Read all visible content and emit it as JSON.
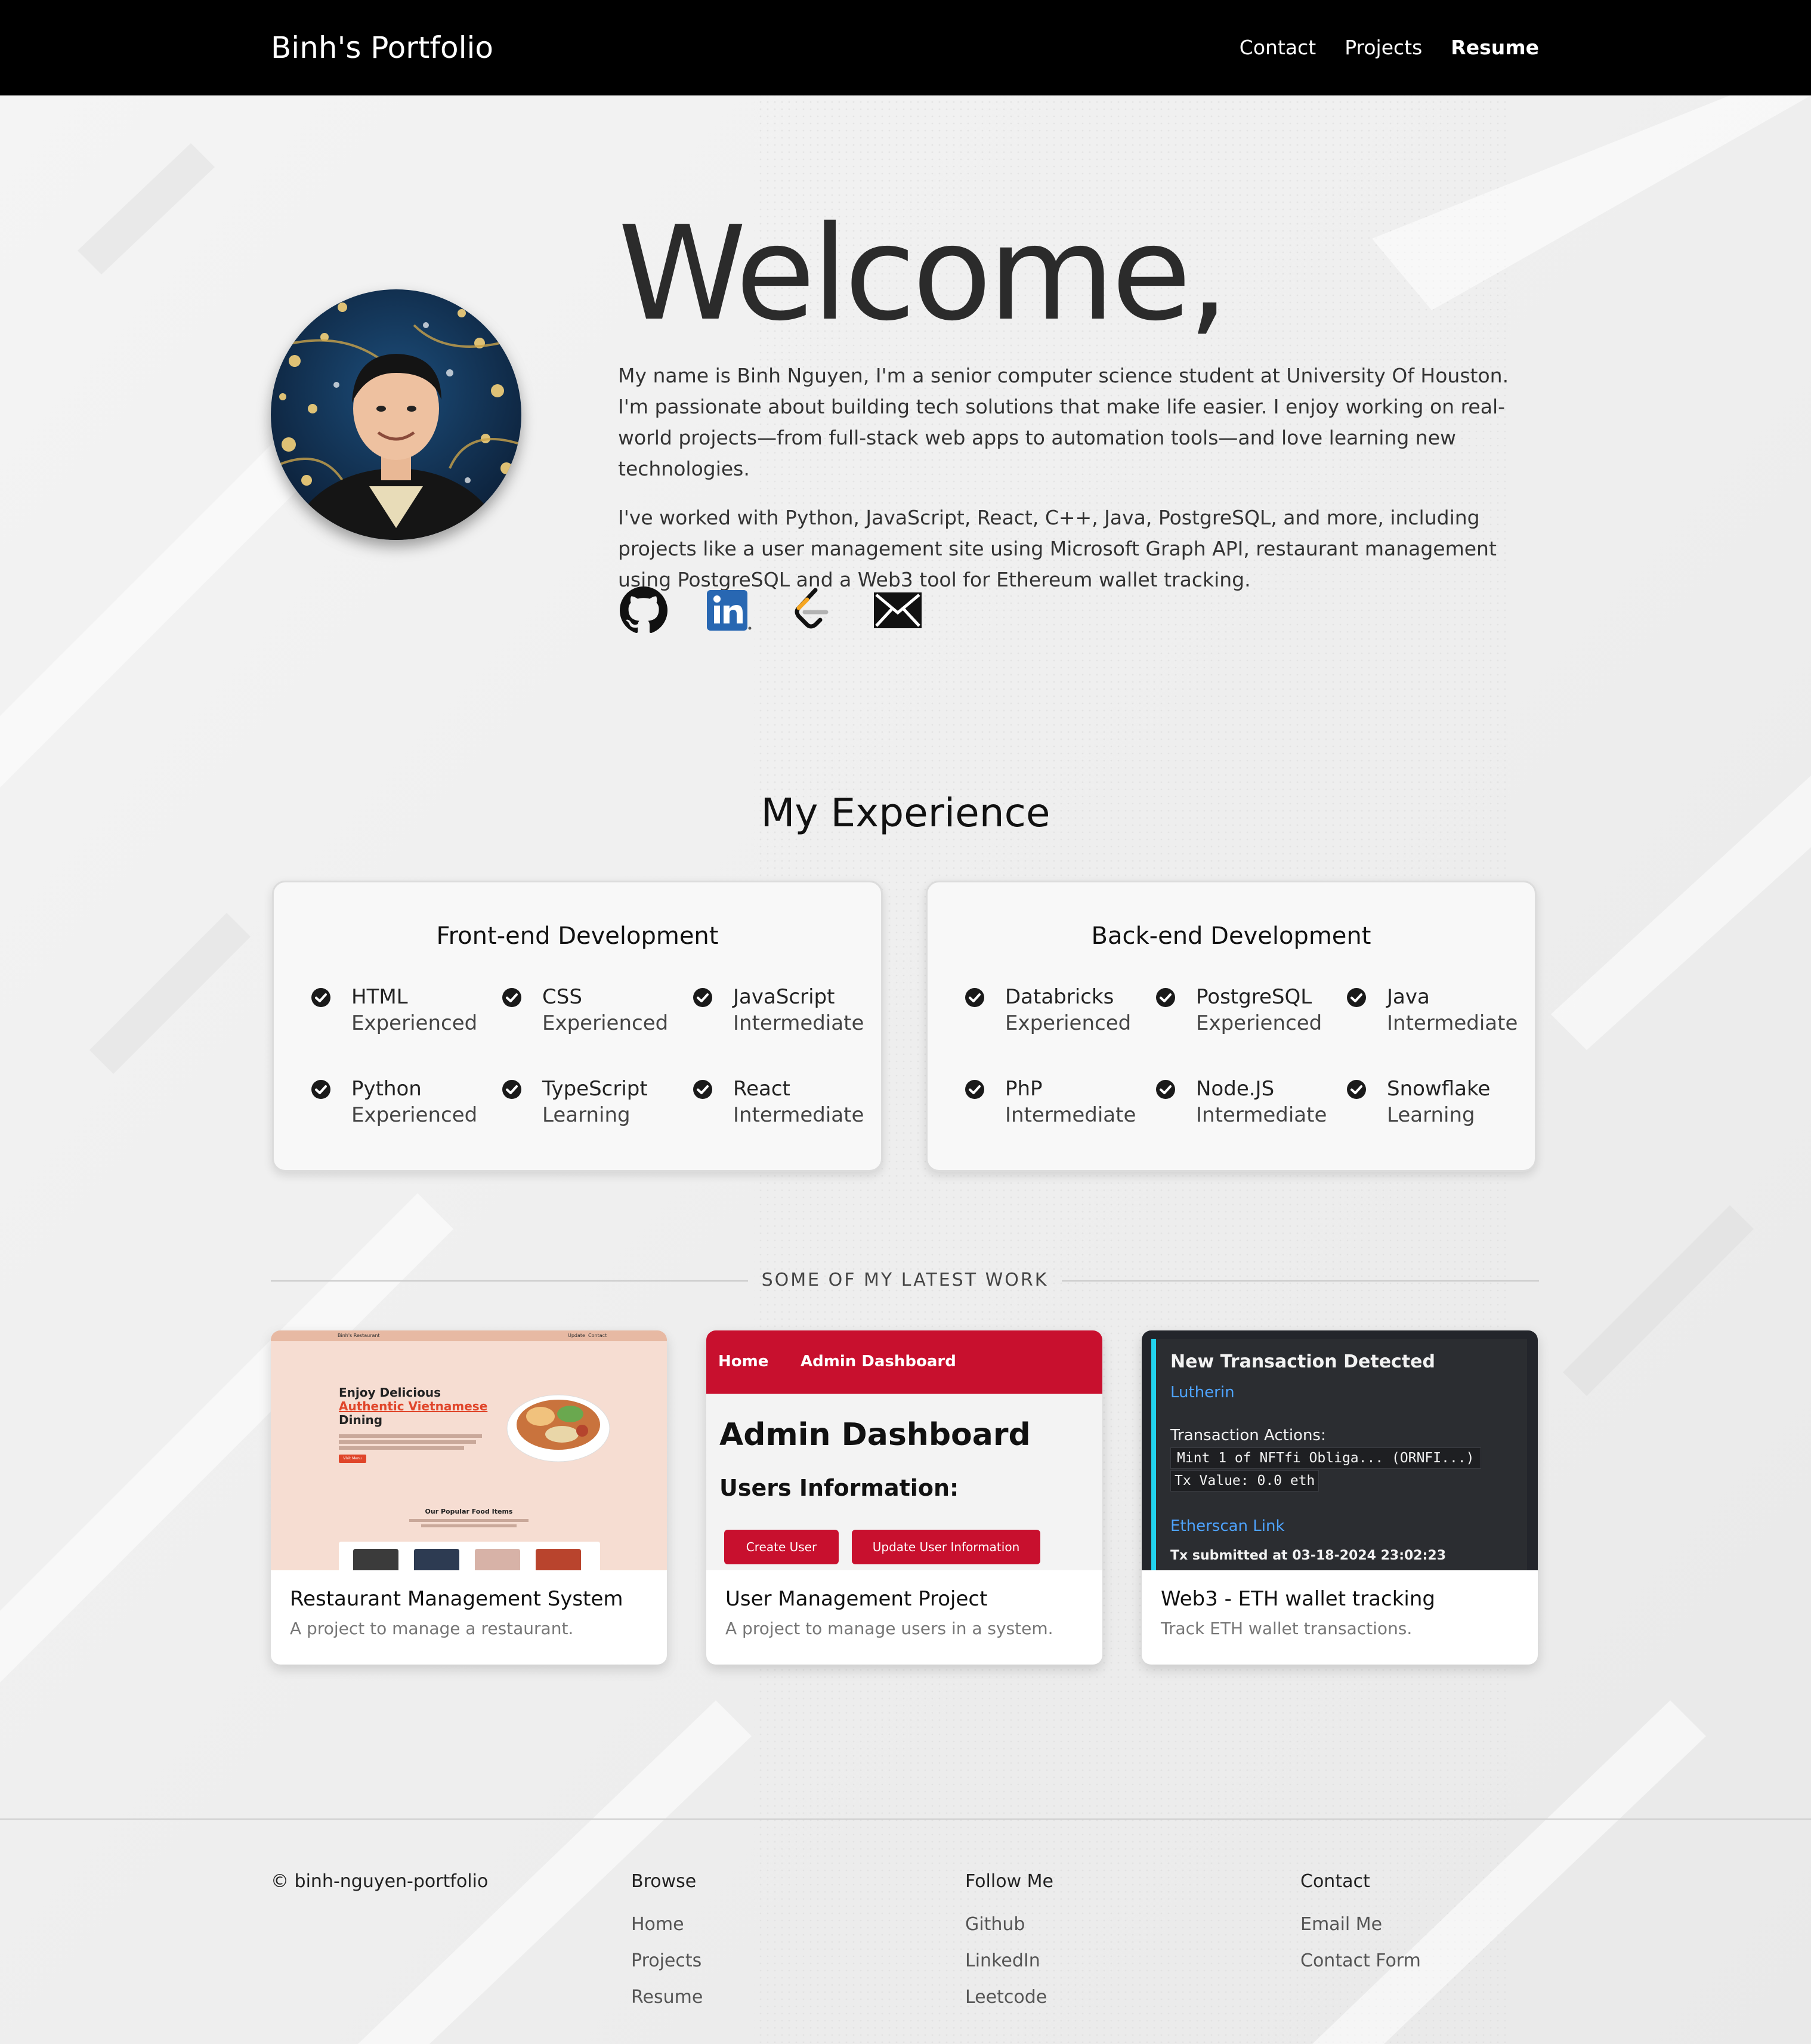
{
  "nav": {
    "brand": "Binh's Portfolio",
    "links": [
      {
        "label": "Contact"
      },
      {
        "label": "Projects"
      },
      {
        "label": "Resume"
      }
    ]
  },
  "hero": {
    "heading": "Welcome,",
    "paragraphs": [
      "My name is Binh Nguyen, I'm a senior computer science student at University Of Houston. I'm passionate about building tech solutions that make life easier. I enjoy working on real-world projects—from full-stack web apps to automation tools—and love learning new technologies.",
      "I've worked with Python, JavaScript, React, C++, Java, PostgreSQL, and more, including projects like a user management site using Microsoft Graph API, restaurant management using PostgreSQL and a Web3 tool for Ethereum wallet tracking."
    ],
    "social_icons": [
      "github-icon",
      "linkedin-icon",
      "leetcode-icon",
      "email-icon"
    ]
  },
  "experience": {
    "title": "My Experience",
    "cards": [
      {
        "title": "Front-end Development",
        "skills": [
          {
            "name": "HTML",
            "level": "Experienced"
          },
          {
            "name": "CSS",
            "level": "Experienced"
          },
          {
            "name": "JavaScript",
            "level": "Intermediate"
          },
          {
            "name": "Python",
            "level": "Experienced"
          },
          {
            "name": "TypeScript",
            "level": "Learning"
          },
          {
            "name": "React",
            "level": "Intermediate"
          }
        ]
      },
      {
        "title": "Back-end Development",
        "skills": [
          {
            "name": "Databricks",
            "level": "Experienced"
          },
          {
            "name": "PostgreSQL",
            "level": "Experienced"
          },
          {
            "name": "Java",
            "level": "Intermediate"
          },
          {
            "name": "PhP",
            "level": "Intermediate"
          },
          {
            "name": "Node.JS",
            "level": "Intermediate"
          },
          {
            "name": "Snowflake",
            "level": "Learning"
          }
        ]
      }
    ]
  },
  "work": {
    "label": "SOME OF MY LATEST WORK",
    "projects": [
      {
        "title": "Restaurant Management System",
        "desc": "A project to manage a restaurant.",
        "thumb": {
          "brand": "Binh's Restaurant",
          "nav": [
            "Update",
            "Contact"
          ],
          "line1": "Enjoy Delicious",
          "line2": "Authentic Vietnamese",
          "line3": "Dining",
          "button": "Visit Menu",
          "popular": "Our Popular Food Items"
        }
      },
      {
        "title": "User Management Project",
        "desc": "A project to manage users in a system.",
        "thumb": {
          "nav_home": "Home",
          "nav_admin": "Admin Dashboard",
          "heading": "Admin Dashboard",
          "sub": "Users Information:",
          "btn_create": "Create User",
          "btn_update": "Update User Information"
        }
      },
      {
        "title": "Web3 - ETH wallet tracking",
        "desc": "Track ETH wallet transactions.",
        "thumb": {
          "heading": "New Transaction Detected",
          "name": "Lutherin",
          "actions_label": "Transaction Actions:",
          "code1": "Mint 1 of NFTfi Obliga... (ORNFI...)",
          "code2": "Tx Value: 0.0 eth",
          "link": "Etherscan Link",
          "submitted": "Tx submitted at 03-18-2024 23:02:23"
        }
      }
    ]
  },
  "footer": {
    "copyright": "© binh-nguyen-portfolio",
    "columns": [
      {
        "heading": "Browse",
        "links": [
          "Home",
          "Projects",
          "Resume"
        ]
      },
      {
        "heading": "Follow Me",
        "links": [
          "Github",
          "LinkedIn",
          "Leetcode"
        ]
      },
      {
        "heading": "Contact",
        "links": [
          "Email Me",
          "Contact Form"
        ]
      }
    ]
  },
  "colors": {
    "nav_bg": "#000000",
    "accent_red": "#c8102e",
    "web3_bg": "#23252b",
    "web3_accent": "#22d3ee",
    "restaurant_bg": "#f6ddd2"
  }
}
